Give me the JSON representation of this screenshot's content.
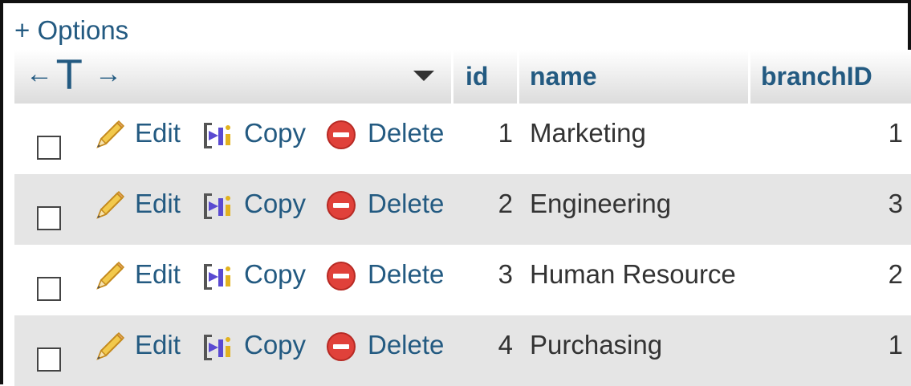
{
  "options_link": "+ Options",
  "header": {
    "arrow_left": "←",
    "arrow_right": "→",
    "tee": "T",
    "columns": [
      "id",
      "name",
      "branchID"
    ]
  },
  "actions": {
    "edit_label": "Edit",
    "copy_label": "Copy",
    "delete_label": "Delete"
  },
  "rows": [
    {
      "id": "1",
      "name": "Marketing",
      "branchID": "1"
    },
    {
      "id": "2",
      "name": "Engineering",
      "branchID": "3"
    },
    {
      "id": "3",
      "name": "Human Resource",
      "branchID": "2"
    },
    {
      "id": "4",
      "name": "Purchasing",
      "branchID": "1"
    }
  ],
  "colors": {
    "link": "#235a81",
    "row_alt": "#e5e5e5",
    "delete_red": "#e0413a",
    "copy_purple": "#5a4ad1"
  }
}
